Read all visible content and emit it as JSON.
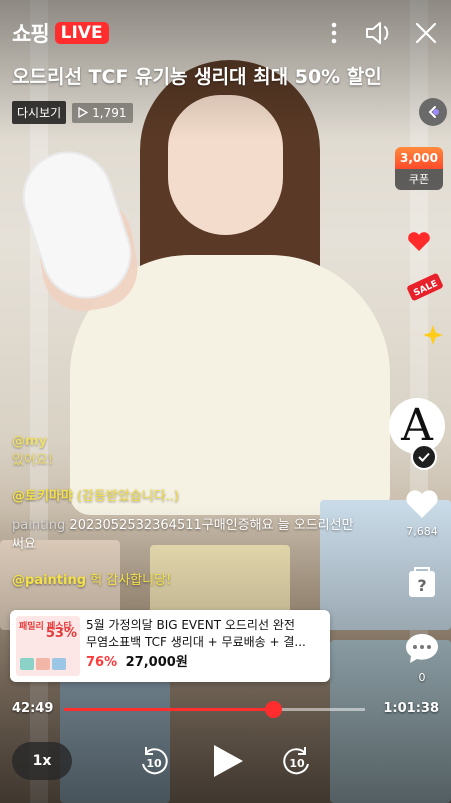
{
  "header": {
    "brand": "쇼핑",
    "live_badge": "LIVE",
    "title": "오드리선 TCF 유기농 생리대 최대 50% 할인",
    "replay_label": "다시보기",
    "views": "1,791"
  },
  "icons": {
    "more": "more-vertical-icon",
    "volume": "speaker-icon",
    "close": "close-icon"
  },
  "rail": {
    "coupon_amount": "3,000",
    "coupon_label": "쿠폰",
    "channel_letter": "A",
    "like_count": "7,684",
    "comment_count": "0"
  },
  "chat": [
    {
      "name": "@my",
      "text": "있어요!"
    },
    {
      "name": "@토키마먀",
      "text": "(감동받았습니다..)"
    },
    {
      "name": "painting",
      "text": "2023052532364511구매인증해요 늘 오드리선만 써요"
    },
    {
      "name": "@painting",
      "text": "헉 감사합니당!"
    }
  ],
  "product": {
    "thumb_promo": "패밀리 페스타",
    "thumb_pct": "53%",
    "name_line1": "5월 가정의달 BIG EVENT 오드리선 완전",
    "name_line2": "무염소표백 TCF 생리대 + 무료배송 + 결...",
    "discount": "76%",
    "price": "27,000원"
  },
  "playback": {
    "current": "42:49",
    "total": "1:01:38",
    "progress_fraction": 0.695,
    "speed": "1x",
    "skip_seconds": "10"
  },
  "colors": {
    "live_red": "#ff2d2d",
    "chat_yellow": "#f3e04a",
    "coupon_orange": "#ff6a33"
  }
}
